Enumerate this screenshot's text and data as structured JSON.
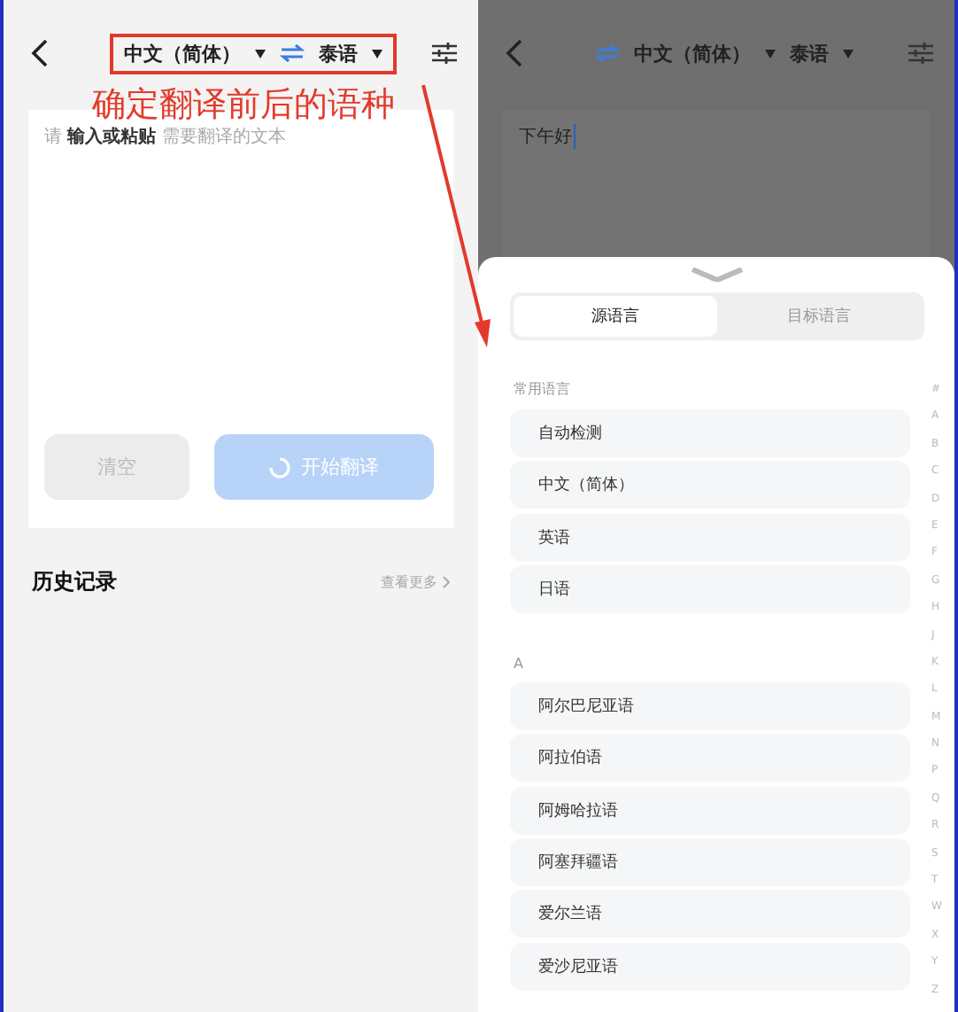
{
  "left": {
    "header": {
      "source_language": "中文（简体）",
      "target_language": "泰语"
    },
    "input": {
      "placeholder": "请 **输入或粘贴** 需要翻译的文本"
    },
    "buttons": [
      {
        "label": "清空",
        "kind": "clear"
      },
      {
        "label": "开始翻译",
        "kind": "translate"
      }
    ],
    "history": {
      "title": "历史记录",
      "more": "查看更多"
    }
  },
  "annotation": {
    "text": "确定翻译前后的语种"
  },
  "right": {
    "header": {
      "source_language": "中文（简体）",
      "target_language": "泰语"
    },
    "input": {
      "value": "下午好"
    },
    "sheet": {
      "tabs": [
        {
          "label": "源语言",
          "selected": true
        },
        {
          "label": "目标语言",
          "selected": false
        }
      ],
      "sections": [
        {
          "title": "常用语言",
          "items": [
            "自动检测",
            "中文（简体）",
            "英语",
            "日语"
          ]
        },
        {
          "title": "A",
          "items": [
            "阿尔巴尼亚语",
            "阿拉伯语",
            "阿姆哈拉语",
            "阿塞拜疆语",
            "爱尔兰语",
            "爱沙尼亚语"
          ]
        }
      ],
      "index": [
        "#",
        "A",
        "B",
        "C",
        "D",
        "E",
        "F",
        "G",
        "H",
        "J",
        "K",
        "L",
        "M",
        "N",
        "P",
        "Q",
        "R",
        "S",
        "T",
        "W",
        "X",
        "Y",
        "Z"
      ]
    }
  }
}
